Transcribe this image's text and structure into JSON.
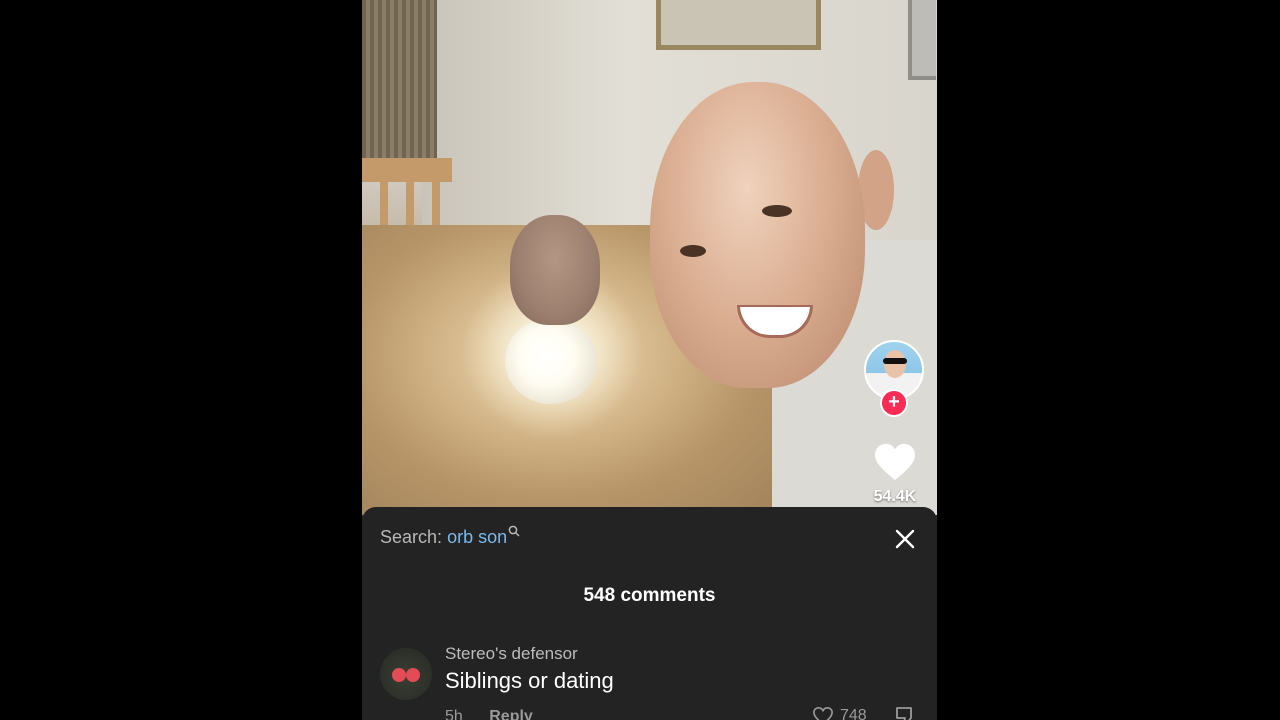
{
  "video": {
    "likes": "54.4K",
    "creator_avatar_icon": "creator-avatar",
    "follow_icon": "plus-icon"
  },
  "comments_panel": {
    "search_label": "Search:",
    "search_term": "orb son",
    "count_label": "548 comments",
    "comments": [
      {
        "username": "Stereo's defensor",
        "text": "Siblings or dating",
        "age": "5h",
        "reply_label": "Reply",
        "likes": "748"
      }
    ]
  },
  "colors": {
    "accent_pink": "#fe2c55",
    "search_link_blue": "#7db8ea",
    "sheet_background": "#232323"
  }
}
